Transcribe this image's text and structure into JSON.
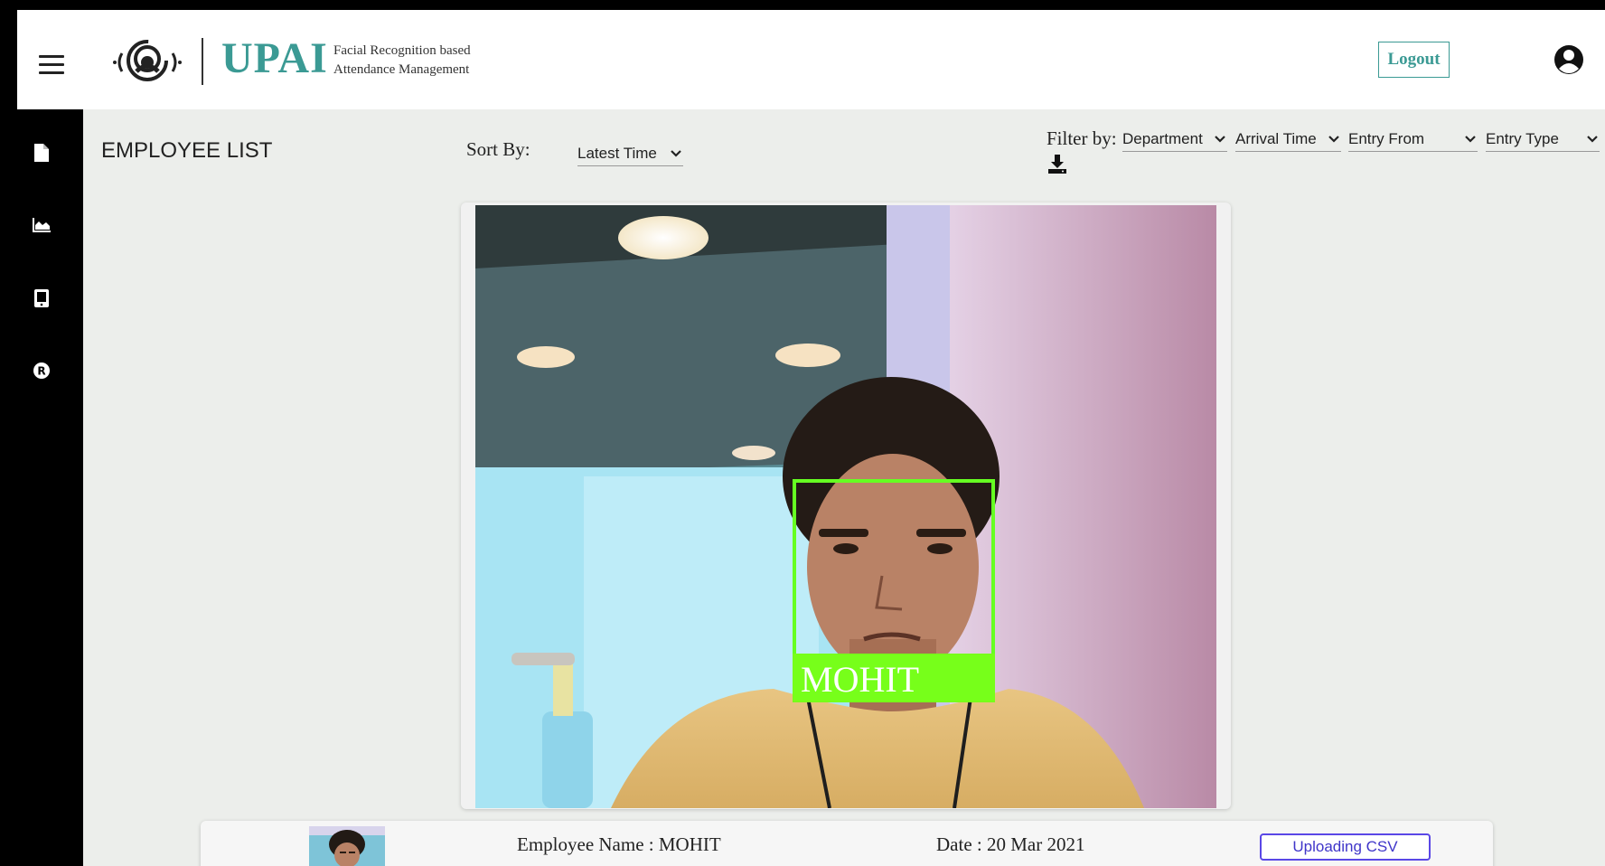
{
  "header": {
    "brand": "UPAI",
    "tagline_line1": "Facial Recognition based",
    "tagline_line2": "Attendance Management",
    "logout_label": "Logout"
  },
  "sidebar": {
    "items": [
      {
        "icon": "document-icon"
      },
      {
        "icon": "area-chart-icon"
      },
      {
        "icon": "tablet-icon"
      },
      {
        "icon": "registered-icon"
      }
    ]
  },
  "main": {
    "title": "EMPLOYEE LIST",
    "sort": {
      "label": "Sort By:",
      "selected": "Latest Time"
    },
    "filter": {
      "label": "Filter by:",
      "department": "Department",
      "arrival_time": "Arrival Time",
      "entry_from": "Entry From",
      "entry_type": "Entry Type"
    },
    "camera": {
      "detected_name": "MOHIT",
      "box_color": "#66ff22"
    },
    "record": {
      "employee_name": "Employee Name : MOHIT",
      "date": "Date : 20 Mar 2021",
      "status_button": "Uploading CSV"
    }
  },
  "colors": {
    "brand": "#3b9a94",
    "button_border": "#5a47e6",
    "background": "#eceeeb"
  }
}
